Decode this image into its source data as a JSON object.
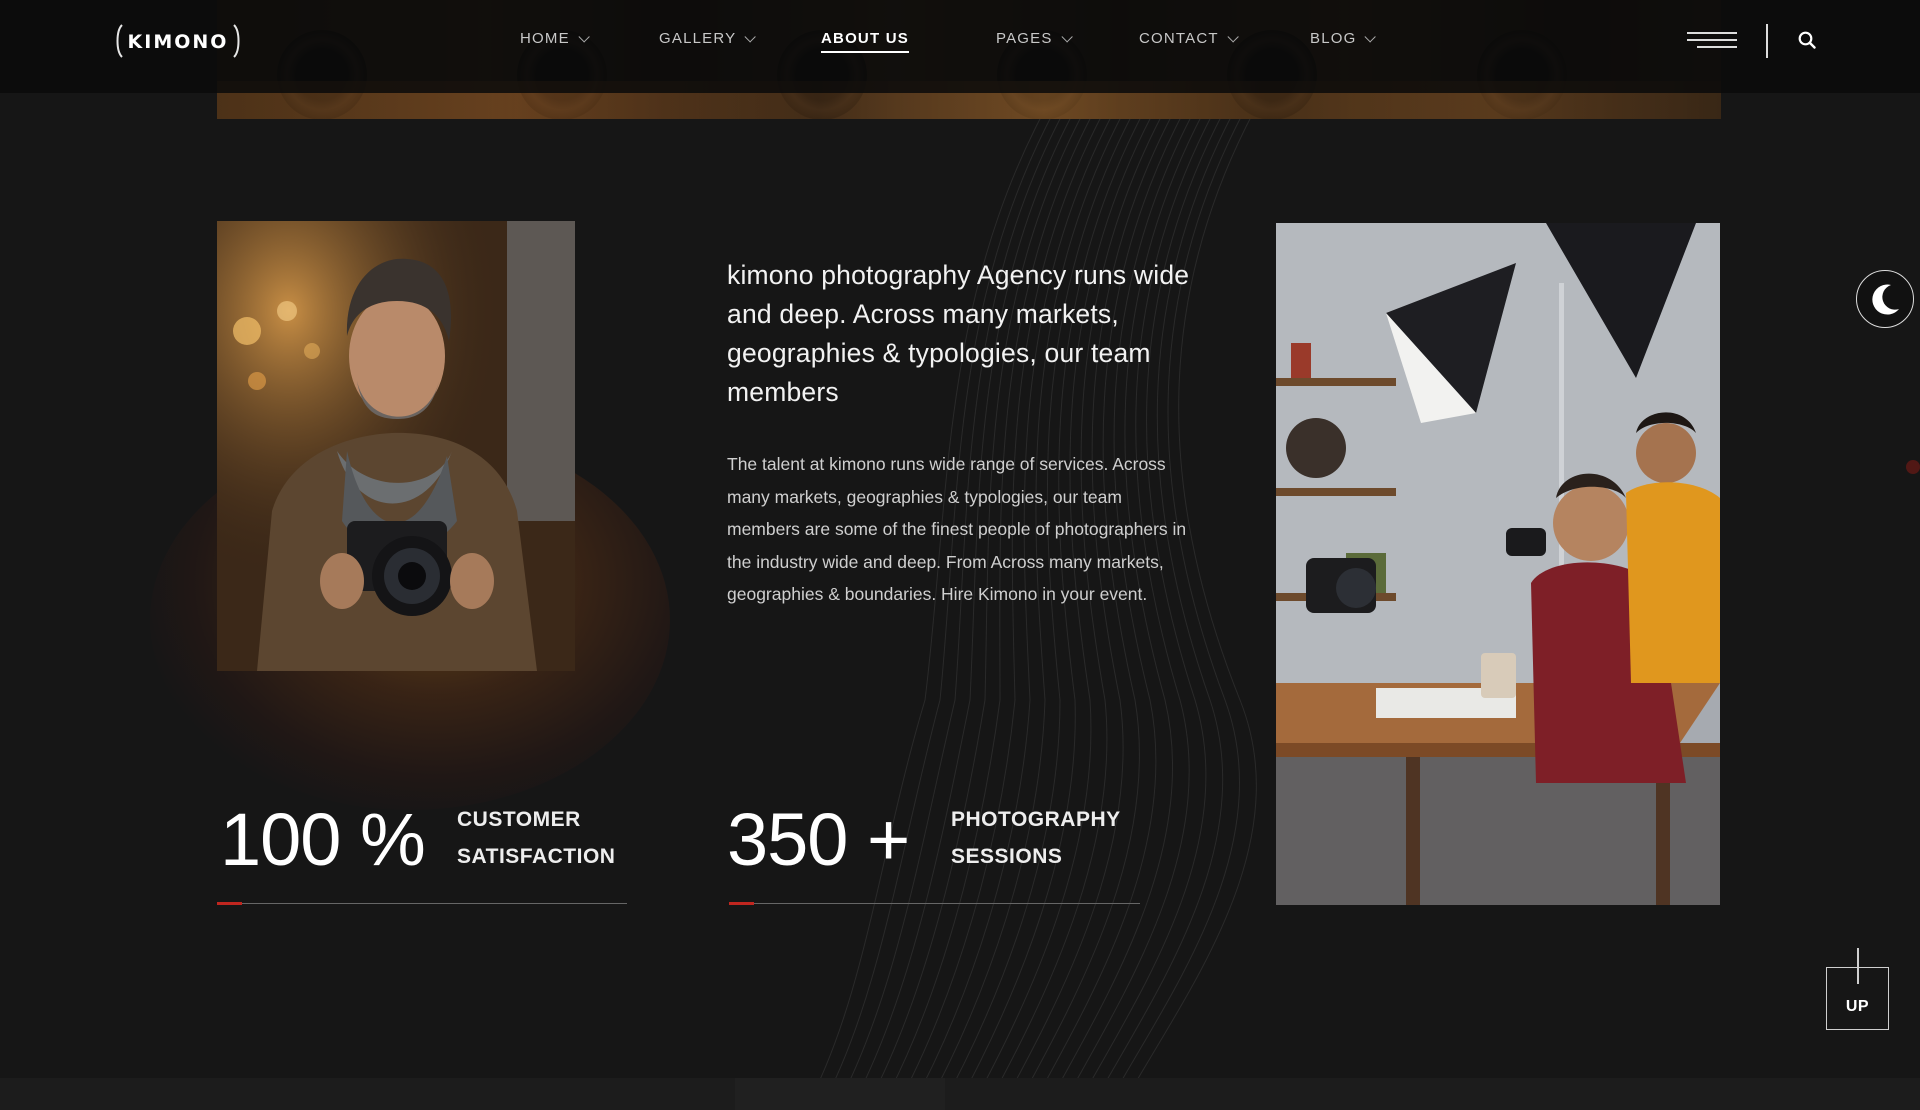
{
  "brand": {
    "logo_text": "KIMONO",
    "accent_color": "#c0261f"
  },
  "nav": {
    "items": [
      {
        "label": "HOME",
        "dropdown": true
      },
      {
        "label": "GALLERY",
        "dropdown": true
      },
      {
        "label": "ABOUT US",
        "dropdown": false,
        "active": true
      },
      {
        "label": "PAGES",
        "dropdown": true
      },
      {
        "label": "CONTACT",
        "dropdown": true
      },
      {
        "label": "BLOG",
        "dropdown": true
      }
    ],
    "menu_icon": "hamburger-icon",
    "search_icon": "search-icon"
  },
  "about": {
    "heading": "kimono photography Agency runs wide and deep. Across many markets, geographies & typologies, our team members",
    "body": "The talent at kimono runs wide range of services. Across many markets, geographies & typologies, our team members are some of the finest people of photographers in the industry wide and deep. From Across many markets, geographies & boundaries. Hire Kimono in your event."
  },
  "stats": [
    {
      "value": "100 %",
      "label_line1": "CUSTOMER",
      "label_line2": "SATISFACTION"
    },
    {
      "value": "350 +",
      "label_line1": "PHOTOGRAPHY",
      "label_line2": "SESSIONS"
    }
  ],
  "floating": {
    "theme_toggle_icon": "moon-icon",
    "scroll_top_label": "UP"
  }
}
